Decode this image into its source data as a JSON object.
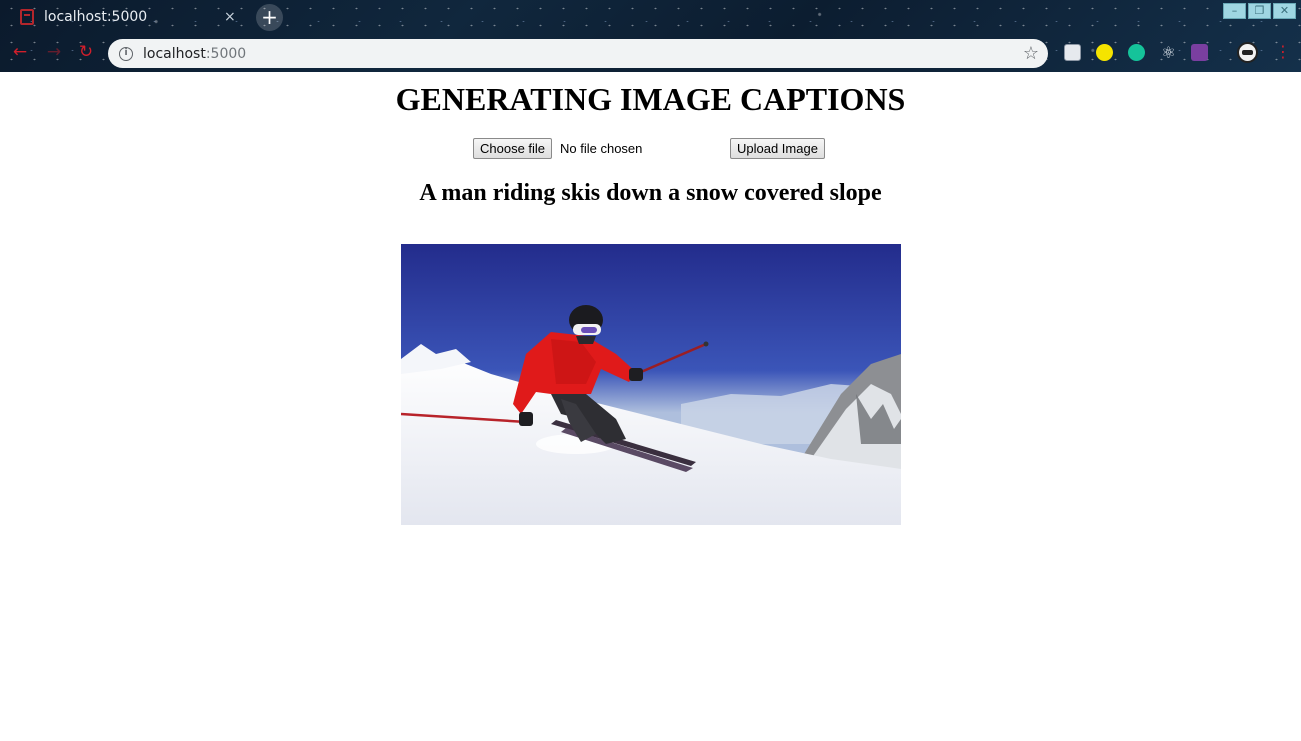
{
  "browser": {
    "tab": {
      "title": "localhost:5000",
      "close_icon": "×"
    },
    "new_tab_icon": "+",
    "window_controls": {
      "minimize": "–",
      "restore": "❐",
      "close": "✕"
    },
    "nav": {
      "back_icon": "←",
      "forward_icon": "→",
      "reload_icon": "↻"
    },
    "address": {
      "host": "localhost",
      "port": ":5000"
    },
    "bookmark_icon": "☆",
    "extensions": [
      "extension-1",
      "extension-2",
      "grammarly-extension",
      "react-devtools-extension",
      "extension-5"
    ],
    "menu_icon": "⋮"
  },
  "page": {
    "title": "GENERATING IMAGE CAPTIONS",
    "choose_file_label": "Choose file",
    "file_status": "No file chosen",
    "upload_label": "Upload Image",
    "caption": "A man riding skis down a snow covered slope"
  },
  "colors": {
    "accent_red": "#d11f2b",
    "omnibox_bg": "#f1f3f4",
    "jacket_red": "#e01a1a",
    "sky_blue": "#2a3a9c"
  }
}
